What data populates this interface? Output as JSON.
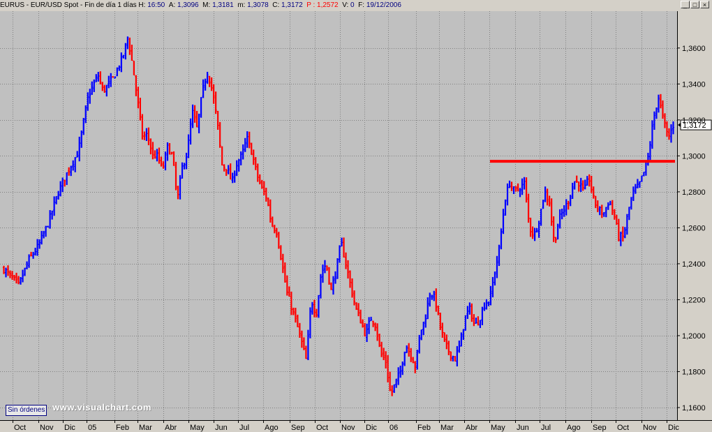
{
  "titlebar": {
    "symbol": "EURUS - EUR/USD Spot - Fin de día 1 días",
    "h_label": "H:",
    "h_value": "16:50",
    "a_label": "A:",
    "a_value": "1,3096",
    "m_label": "M:",
    "m_value": "1,3181",
    "mm_label": "m:",
    "mm_value": "1,3078",
    "c_label": "C:",
    "c_value": "1,3172",
    "p_label": "P :",
    "p_value": "1,2572",
    "v_label": "V:",
    "v_value": "0",
    "f_label": "F:",
    "f_value": "19/12/2006",
    "buttons": [
      "_",
      "□",
      "×"
    ]
  },
  "orders_button": "Sin órdenes",
  "watermark": "www.visualchart.com",
  "colors": {
    "bg": "#c0c0c0",
    "up": "#0000ff",
    "down": "#ff0000",
    "resistance": "#ff0000",
    "grid": "#808080"
  },
  "chart_data": {
    "type": "ohlc",
    "instrument": "EUR/USD Spot",
    "price_ticks": [
      "1,3600",
      "1,3400",
      "1,3200",
      "1,3000",
      "1,2800",
      "1,2600",
      "1,2400",
      "1,2200",
      "1,2000",
      "1,1800",
      "1,1600"
    ],
    "price_tick_values": [
      1.36,
      1.34,
      1.32,
      1.3,
      1.28,
      1.26,
      1.24,
      1.22,
      1.2,
      1.18,
      1.16
    ],
    "ylim": [
      1.153,
      1.3805
    ],
    "month_labels": [
      "Oct",
      "Nov",
      "Dic",
      "05",
      "Feb",
      "Mar",
      "Abr",
      "May",
      "Jun",
      "Jul",
      "Ago",
      "Sep",
      "Oct",
      "Nov",
      "Dic",
      "06",
      "Feb",
      "Mar",
      "Abr",
      "May",
      "Jun",
      "Jul",
      "Ago",
      "Sep",
      "Oct",
      "Nov",
      "Dic"
    ],
    "last_price_label": "1,3172",
    "last_price": 1.3172,
    "resistance_level": 1.297,
    "resistance_from": "May",
    "grid": true,
    "anchors": [
      [
        0,
        1.237
      ],
      [
        3,
        1.228
      ],
      [
        5,
        1.242
      ],
      [
        7,
        1.25
      ],
      [
        9,
        1.263
      ],
      [
        11,
        1.28
      ],
      [
        13,
        1.292
      ],
      [
        15,
        1.302
      ],
      [
        17,
        1.333
      ],
      [
        19,
        1.345
      ],
      [
        20,
        1.336
      ],
      [
        22,
        1.343
      ],
      [
        24,
        1.355
      ],
      [
        25,
        1.366
      ],
      [
        26,
        1.35
      ],
      [
        28,
        1.31
      ],
      [
        29,
        1.312
      ],
      [
        30,
        1.3
      ],
      [
        31,
        1.3
      ],
      [
        32,
        1.292
      ],
      [
        33,
        1.305
      ],
      [
        34,
        1.3
      ],
      [
        35,
        1.275
      ],
      [
        36,
        1.294
      ],
      [
        37,
        1.302
      ],
      [
        38,
        1.325
      ],
      [
        39,
        1.315
      ],
      [
        40,
        1.335
      ],
      [
        41,
        1.347
      ],
      [
        42,
        1.337
      ],
      [
        43,
        1.32
      ],
      [
        44,
        1.295
      ],
      [
        45,
        1.293
      ],
      [
        46,
        1.285
      ],
      [
        47,
        1.296
      ],
      [
        48,
        1.3
      ],
      [
        49,
        1.31
      ],
      [
        50,
        1.302
      ],
      [
        51,
        1.29
      ],
      [
        52,
        1.282
      ],
      [
        53,
        1.277
      ],
      [
        54,
        1.262
      ],
      [
        55,
        1.258
      ],
      [
        56,
        1.242
      ],
      [
        57,
        1.225
      ],
      [
        58,
        1.216
      ],
      [
        59,
        1.207
      ],
      [
        60,
        1.197
      ],
      [
        61,
        1.186
      ],
      [
        62,
        1.22
      ],
      [
        63,
        1.212
      ],
      [
        64,
        1.235
      ],
      [
        65,
        1.24
      ],
      [
        66,
        1.225
      ],
      [
        67,
        1.236
      ],
      [
        68,
        1.252
      ],
      [
        69,
        1.24
      ],
      [
        70,
        1.227
      ],
      [
        71,
        1.215
      ],
      [
        72,
        1.208
      ],
      [
        73,
        1.2
      ],
      [
        74,
        1.21
      ],
      [
        75,
        1.206
      ],
      [
        76,
        1.19
      ],
      [
        77,
        1.186
      ],
      [
        78,
        1.167
      ],
      [
        79,
        1.174
      ],
      [
        80,
        1.18
      ],
      [
        81,
        1.195
      ],
      [
        82,
        1.19
      ],
      [
        83,
        1.183
      ],
      [
        84,
        1.202
      ],
      [
        85,
        1.21
      ],
      [
        86,
        1.225
      ],
      [
        87,
        1.22
      ],
      [
        88,
        1.205
      ],
      [
        89,
        1.195
      ],
      [
        90,
        1.19
      ],
      [
        91,
        1.187
      ],
      [
        92,
        1.195
      ],
      [
        93,
        1.21
      ],
      [
        94,
        1.215
      ],
      [
        95,
        1.205
      ],
      [
        96,
        1.21
      ],
      [
        97,
        1.218
      ],
      [
        98,
        1.22
      ],
      [
        99,
        1.235
      ],
      [
        100,
        1.25
      ],
      [
        101,
        1.275
      ],
      [
        102,
        1.285
      ],
      [
        103,
        1.28
      ],
      [
        104,
        1.282
      ],
      [
        105,
        1.285
      ],
      [
        106,
        1.26
      ],
      [
        107,
        1.256
      ],
      [
        108,
        1.265
      ],
      [
        109,
        1.28
      ],
      [
        110,
        1.275
      ],
      [
        111,
        1.251
      ],
      [
        112,
        1.265
      ],
      [
        113,
        1.27
      ],
      [
        114,
        1.276
      ],
      [
        115,
        1.286
      ],
      [
        116,
        1.285
      ],
      [
        117,
        1.28
      ],
      [
        118,
        1.288
      ],
      [
        119,
        1.275
      ],
      [
        120,
        1.27
      ],
      [
        121,
        1.268
      ],
      [
        122,
        1.275
      ],
      [
        123,
        1.268
      ],
      [
        124,
        1.255
      ],
      [
        125,
        1.255
      ],
      [
        126,
        1.27
      ],
      [
        127,
        1.28
      ],
      [
        128,
        1.283
      ],
      [
        129,
        1.29
      ],
      [
        130,
        1.3
      ],
      [
        131,
        1.32
      ],
      [
        132,
        1.333
      ],
      [
        133,
        1.32
      ],
      [
        134,
        1.31
      ],
      [
        135,
        1.317
      ]
    ],
    "anchor_span": 135
  }
}
